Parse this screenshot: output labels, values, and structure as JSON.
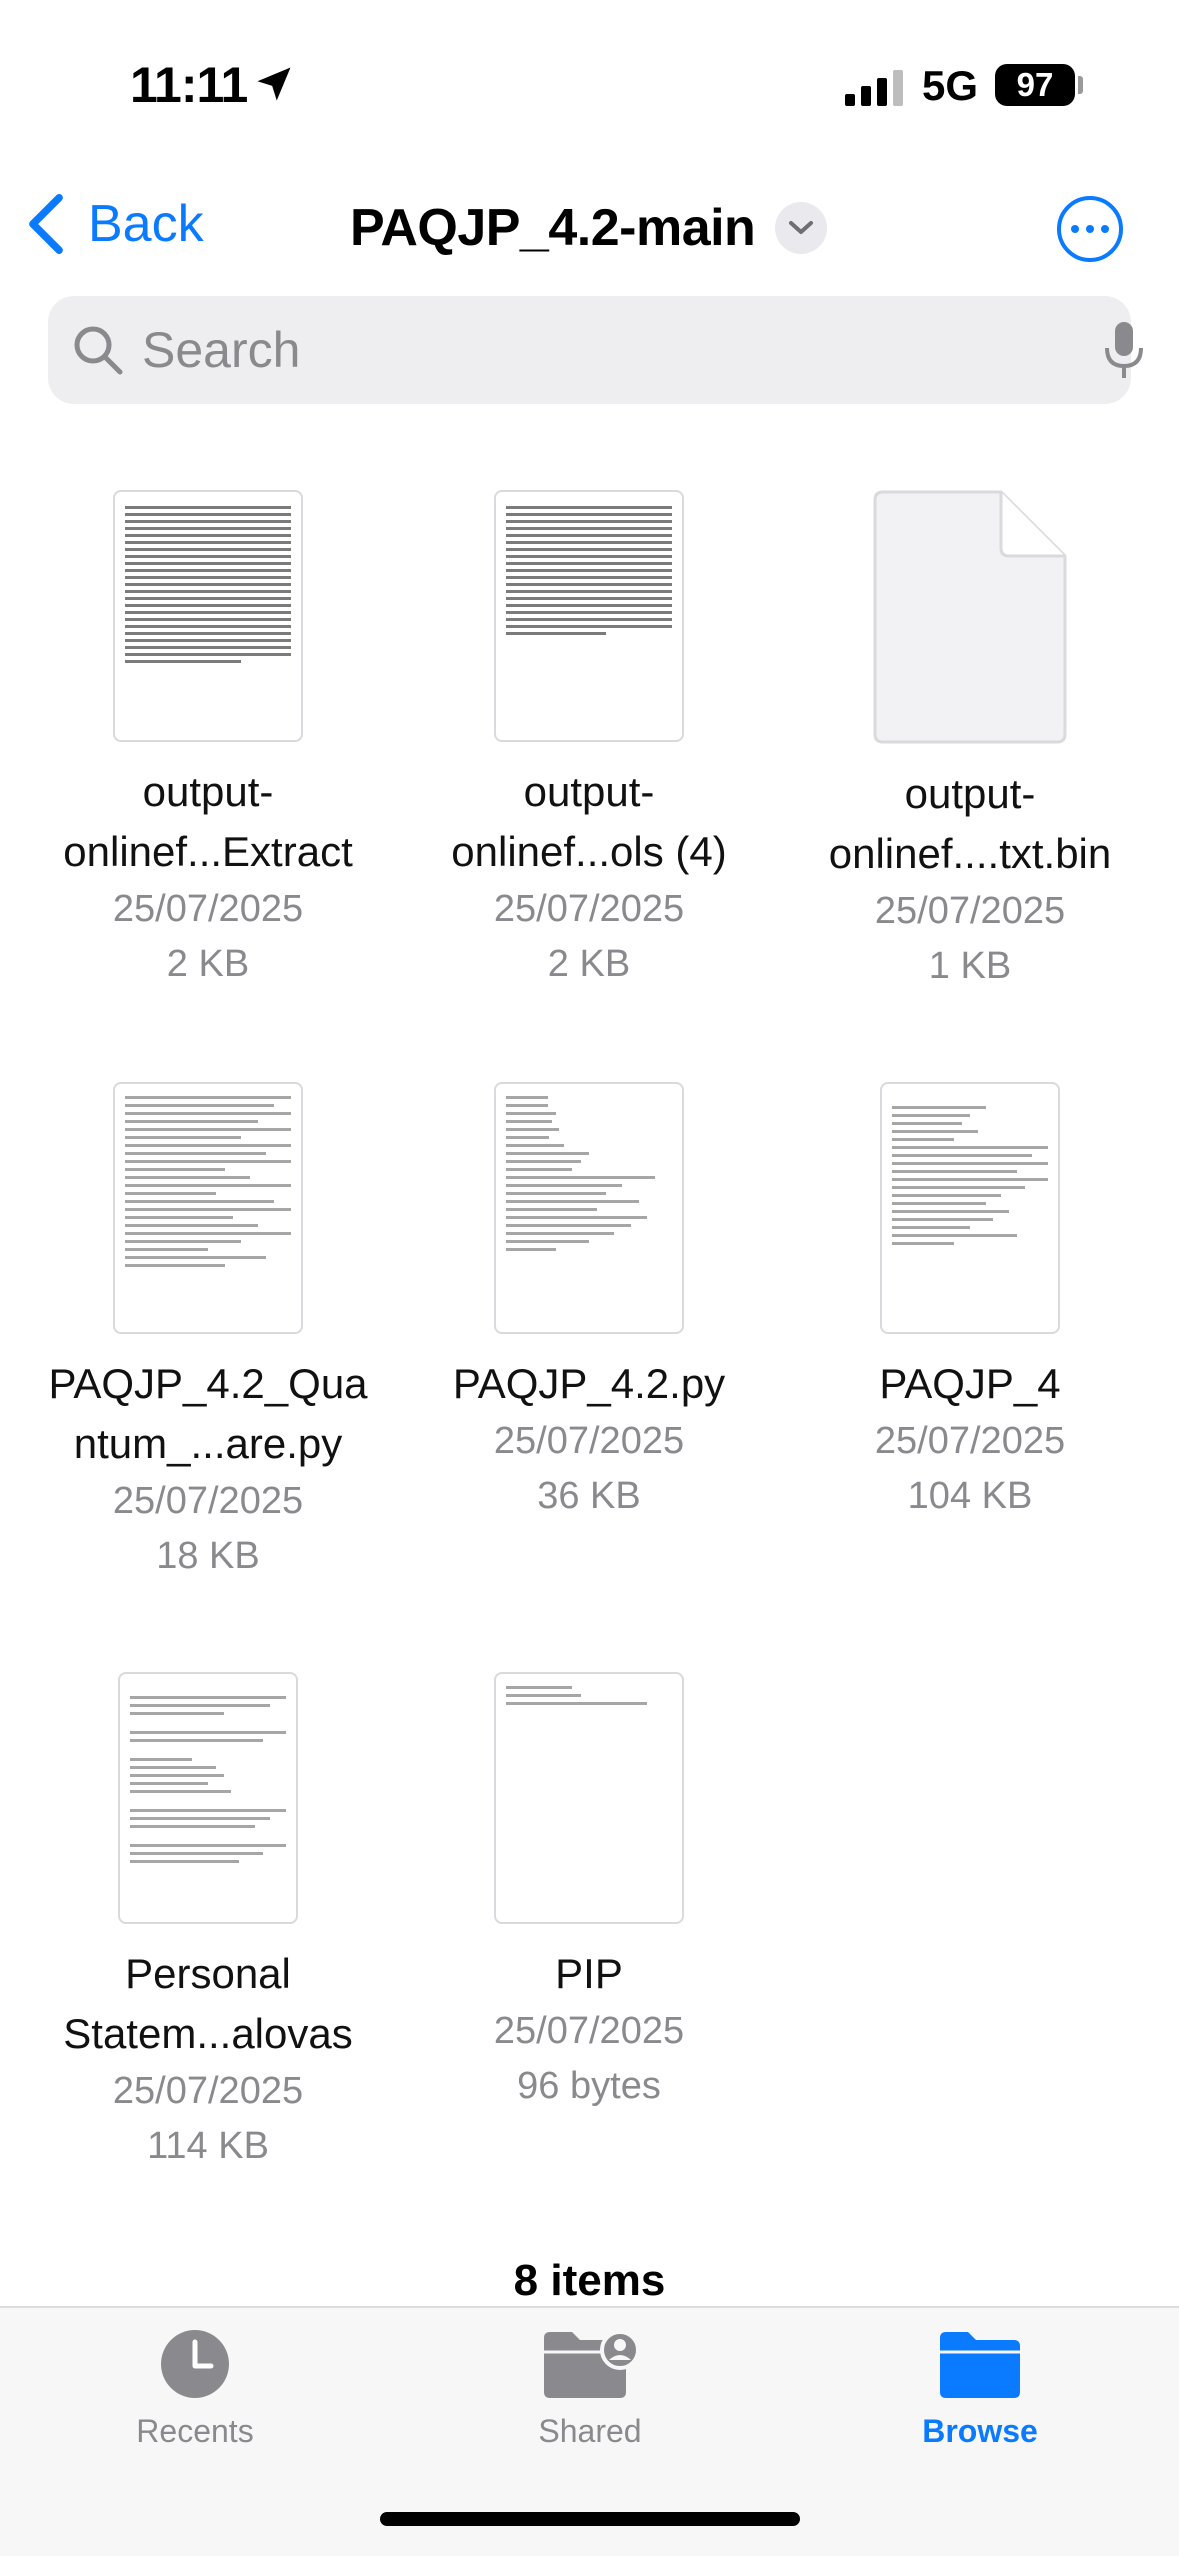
{
  "status": {
    "time": "11:11",
    "network": "5G",
    "battery": "97"
  },
  "nav": {
    "back_label": "Back",
    "title": "PAQJP_4.2-main"
  },
  "search": {
    "placeholder": "Search"
  },
  "files": [
    {
      "name_line1": "output-",
      "name_line2": "onlinef...Extract",
      "date": "25/07/2025",
      "size": "2 KB"
    },
    {
      "name_line1": "output-",
      "name_line2": "onlinef...ols (4)",
      "date": "25/07/2025",
      "size": "2 KB"
    },
    {
      "name_line1": "output-",
      "name_line2": "onlinef....txt.bin",
      "date": "25/07/2025",
      "size": "1 KB"
    },
    {
      "name_line1": "PAQJP_4.2_Qua",
      "name_line2": "ntum_...are.py",
      "date": "25/07/2025",
      "size": "18 KB"
    },
    {
      "name_line1": "PAQJP_4.2.py",
      "name_line2": "",
      "date": "25/07/2025",
      "size": "36 KB"
    },
    {
      "name_line1": "PAQJP_4",
      "name_line2": "",
      "date": "25/07/2025",
      "size": "104 KB"
    },
    {
      "name_line1": "Personal",
      "name_line2": "Statem...alovas",
      "date": "25/07/2025",
      "size": "114 KB"
    },
    {
      "name_line1": "PIP",
      "name_line2": "",
      "date": "25/07/2025",
      "size": "96 bytes"
    }
  ],
  "footer": {
    "count": "8 items"
  },
  "tabs": [
    {
      "label": "Recents",
      "icon": "clock-icon"
    },
    {
      "label": "Shared",
      "icon": "shared-folder-icon"
    },
    {
      "label": "Browse",
      "icon": "folder-icon"
    }
  ],
  "colors": {
    "accent": "#0a7aff",
    "secondary_text": "#8a8a8e"
  }
}
